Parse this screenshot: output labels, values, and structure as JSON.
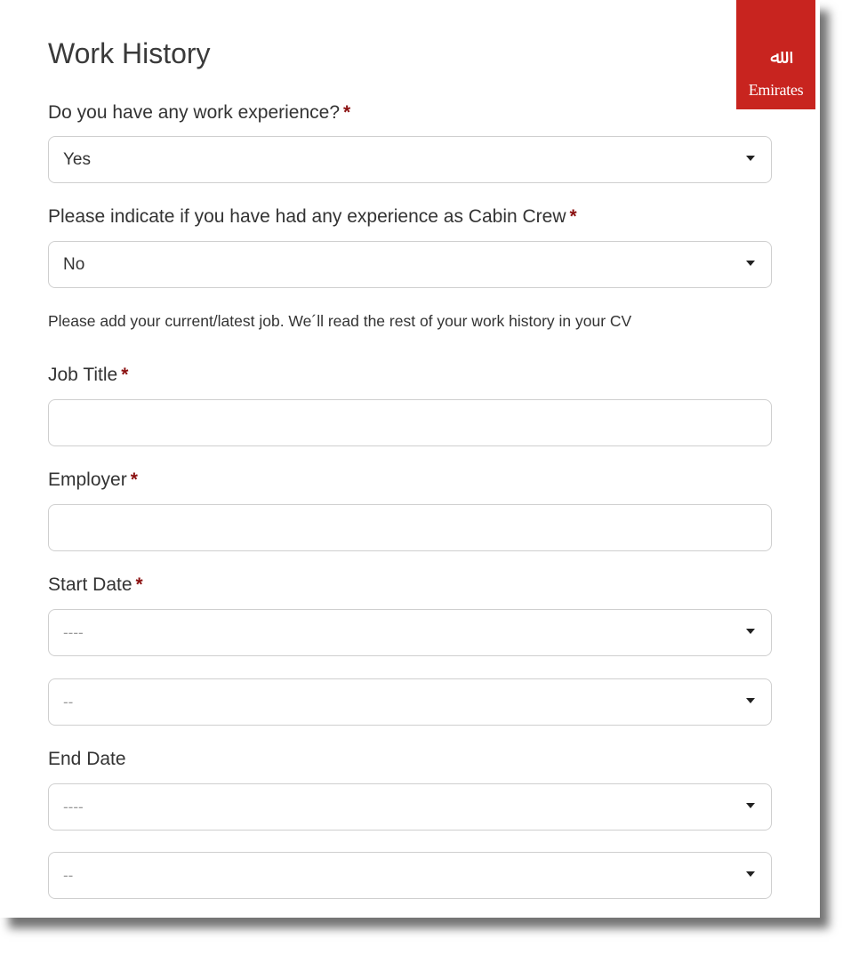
{
  "brand": {
    "name": "Emirates",
    "color": "#c8241f"
  },
  "section_title": "Work History",
  "fields": {
    "work_experience": {
      "label": "Do you have any work experience?",
      "required": "*",
      "value": "Yes"
    },
    "cabin_crew": {
      "label": "Please indicate if you have had any experience as Cabin Crew",
      "required": "*",
      "value": "No"
    },
    "note": "Please add your current/latest job. We´ll read the rest of your work history in your CV",
    "job_title": {
      "label": "Job Title",
      "required": "*",
      "value": ""
    },
    "employer": {
      "label": "Employer",
      "required": "*",
      "value": ""
    },
    "start_date": {
      "label": "Start Date",
      "required": "*",
      "year": "----",
      "month": "--"
    },
    "end_date": {
      "label": "End Date",
      "year": "----",
      "month": "--"
    }
  },
  "icons": {
    "dropdown": "caret-down-icon",
    "logo": "emirates-logo"
  }
}
